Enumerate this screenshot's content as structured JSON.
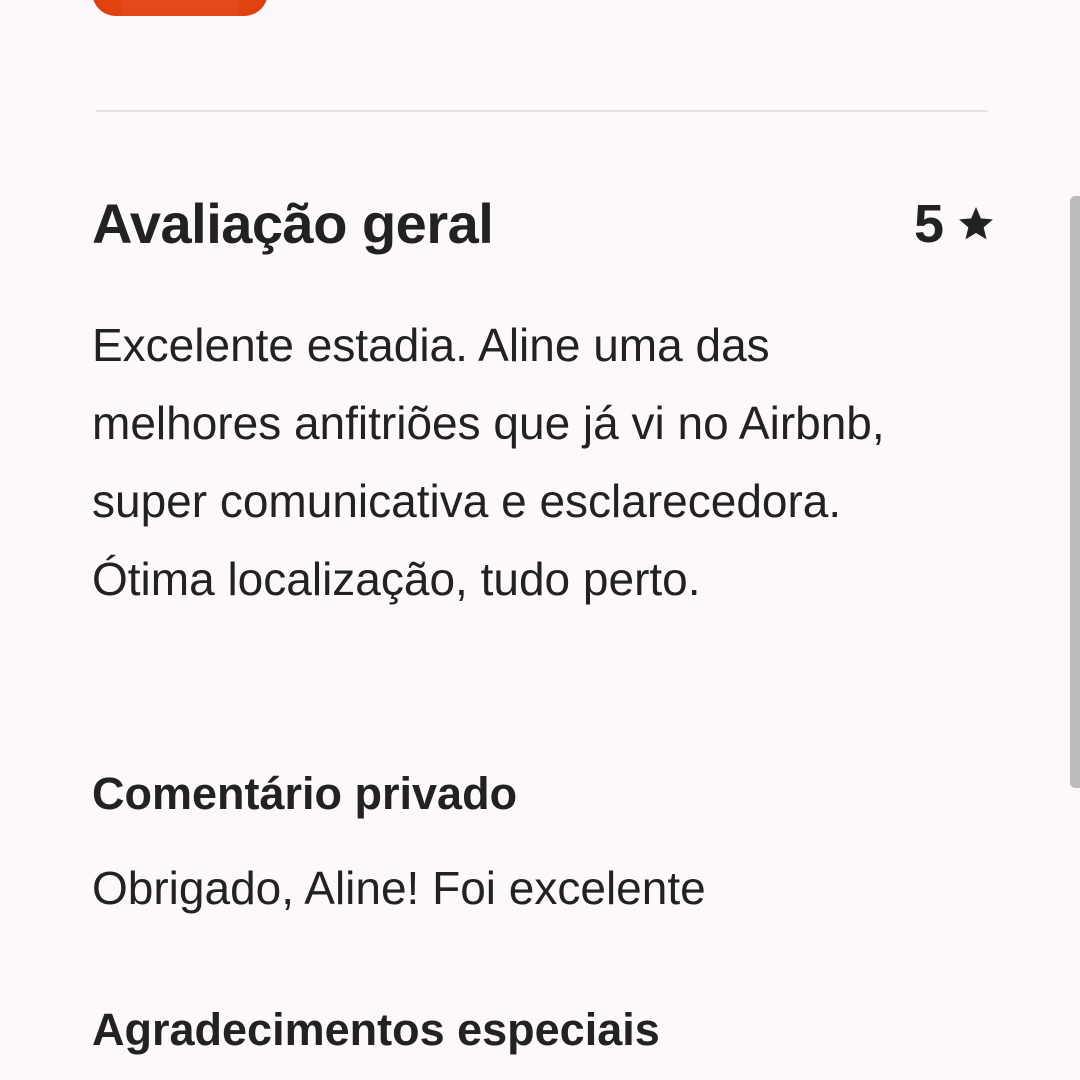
{
  "review": {
    "section_title": "Avaliação geral",
    "rating_value": "5",
    "rating_icon": "star-icon",
    "text": "Excelente estadia. Aline uma das melhores anfitriões que já vi no Airbnb, super comunicativa e esclarecedora. Ótima localização, tudo perto."
  },
  "private_comment": {
    "title": "Comentário privado",
    "text": "Obrigado, Aline! Foi excelente"
  },
  "special_thanks": {
    "title": "Agradecimentos especiais"
  },
  "colors": {
    "background": "#fdf8fc",
    "text": "#222222",
    "avatar": "#f3501a",
    "divider": "#e6e1e5",
    "scrollbar": "#bdbabd"
  }
}
